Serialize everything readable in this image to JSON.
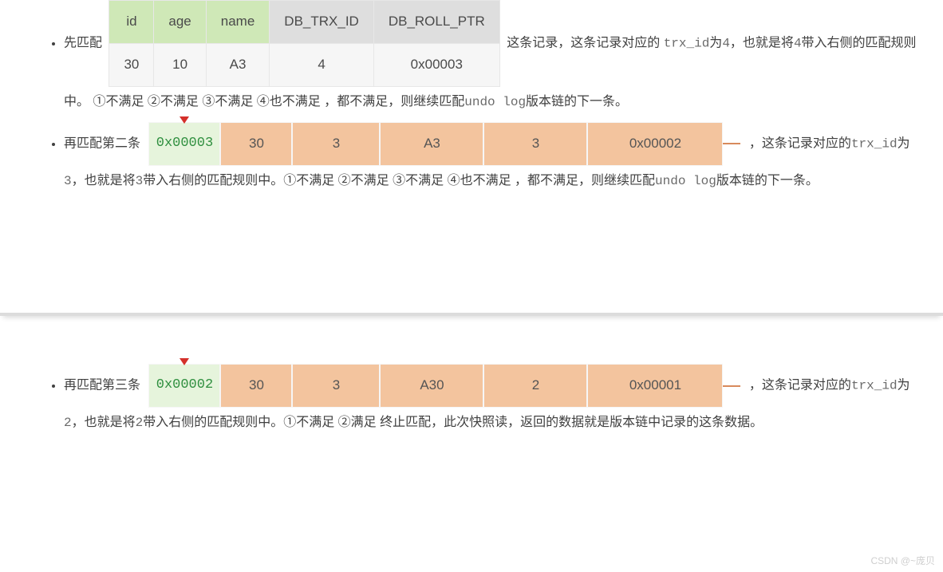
{
  "bullets": {
    "b1": {
      "prefix": "先匹配",
      "table": {
        "headers": [
          "id",
          "age",
          "name",
          "DB_TRX_ID",
          "DB_ROLL_PTR"
        ],
        "row": [
          "30",
          "10",
          "A3",
          "4",
          "0x00003"
        ]
      },
      "after_table": "这条记录，这条记录对应的",
      "line2a": "trx_id",
      "line2b": "为",
      "line2c": "4",
      "line2d": "，也就是将",
      "line2e": "4",
      "line2f": "带入右侧的匹配规则中。  ①不满足  ②不满足  ③不满足  ④也不满足  ，都不满足，则继续匹配",
      "line2g": "undo log",
      "line2h": "版本链的下一条。"
    },
    "b2": {
      "prefix": "再匹配第二条",
      "row": {
        "addr": "0x00003",
        "cells": [
          "30",
          "3",
          "A3",
          "3",
          "0x00002"
        ]
      },
      "after_row": "，这条记录对应的",
      "line2a": "trx_id",
      "line2b": "为",
      "line2c": "3",
      "line2d": "，也就是将",
      "line2e": "3",
      "line2f": "带入右侧的匹配规则中。①不满足  ②不满足  ③不满足  ④也不满足  ，都不满足，则继续匹配",
      "line2g": "undo log",
      "line2h": "版本链的下一条。"
    },
    "b3": {
      "prefix": "再匹配第三条",
      "row": {
        "addr": "0x00002",
        "cells": [
          "30",
          "3",
          "A30",
          "2",
          "0x00001"
        ]
      },
      "after_row": "，这条记录对应的",
      "line2a": "trx_id",
      "line2b": "为",
      "line2c": "2",
      "line2d": "，也就是将",
      "line2e": "2",
      "line2f": "带入右侧的匹配规则中。①不满足  ②满足  终止匹配，此次快照读，返回的数据就是版本链中记录的这条数据。"
    }
  },
  "watermark": "CSDN @~庞贝"
}
